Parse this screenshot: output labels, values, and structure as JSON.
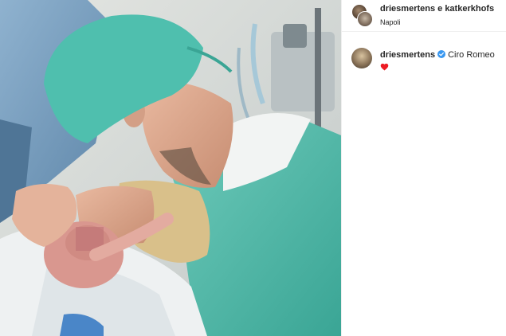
{
  "post": {
    "header": {
      "authors": "driesmertens e katkerkhofs",
      "location": "Napoli"
    },
    "caption": {
      "username": "driesmertens",
      "text": "Ciro Romeo",
      "emoji": "red-heart",
      "verified": true
    },
    "colors": {
      "scrub_green": "#4fbfae",
      "verified_blue": "#3897f0",
      "heart_red": "#ed1c24"
    }
  }
}
